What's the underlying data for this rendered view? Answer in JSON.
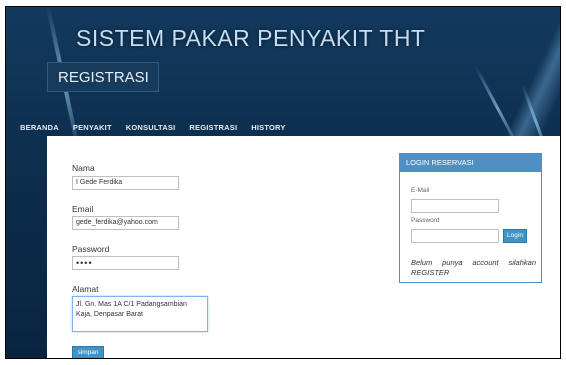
{
  "site": {
    "title": "SISTEM PAKAR PENYAKIT THT"
  },
  "page": {
    "title": "REGISTRASI"
  },
  "nav": {
    "items": [
      "BERANDA",
      "PENYAKIT",
      "KONSULTASI",
      "REGISTRASI",
      "HISTORY"
    ]
  },
  "form": {
    "nama_label": "Nama",
    "nama_value": "I Gede Ferdika",
    "email_label": "Email",
    "email_value": "gede_ferdika@yahoo.com",
    "password_label": "Password",
    "password_value": "••••",
    "alamat_label": "Alamat",
    "alamat_value": "Jl. Gn. Mas 1A C/1 Padangsambian Kaja, Denpasar Barat",
    "submit_label": "simpan"
  },
  "login": {
    "title": "LOGIN RESERVASI",
    "email_label": "E-Mail",
    "password_label": "Password",
    "button_label": "Login",
    "note": "Belum punya account silahkan REGISTER"
  },
  "colors": {
    "accent": "#4f8fc4",
    "header_bg": "#0e2f4e",
    "button": "#3f93c6"
  }
}
